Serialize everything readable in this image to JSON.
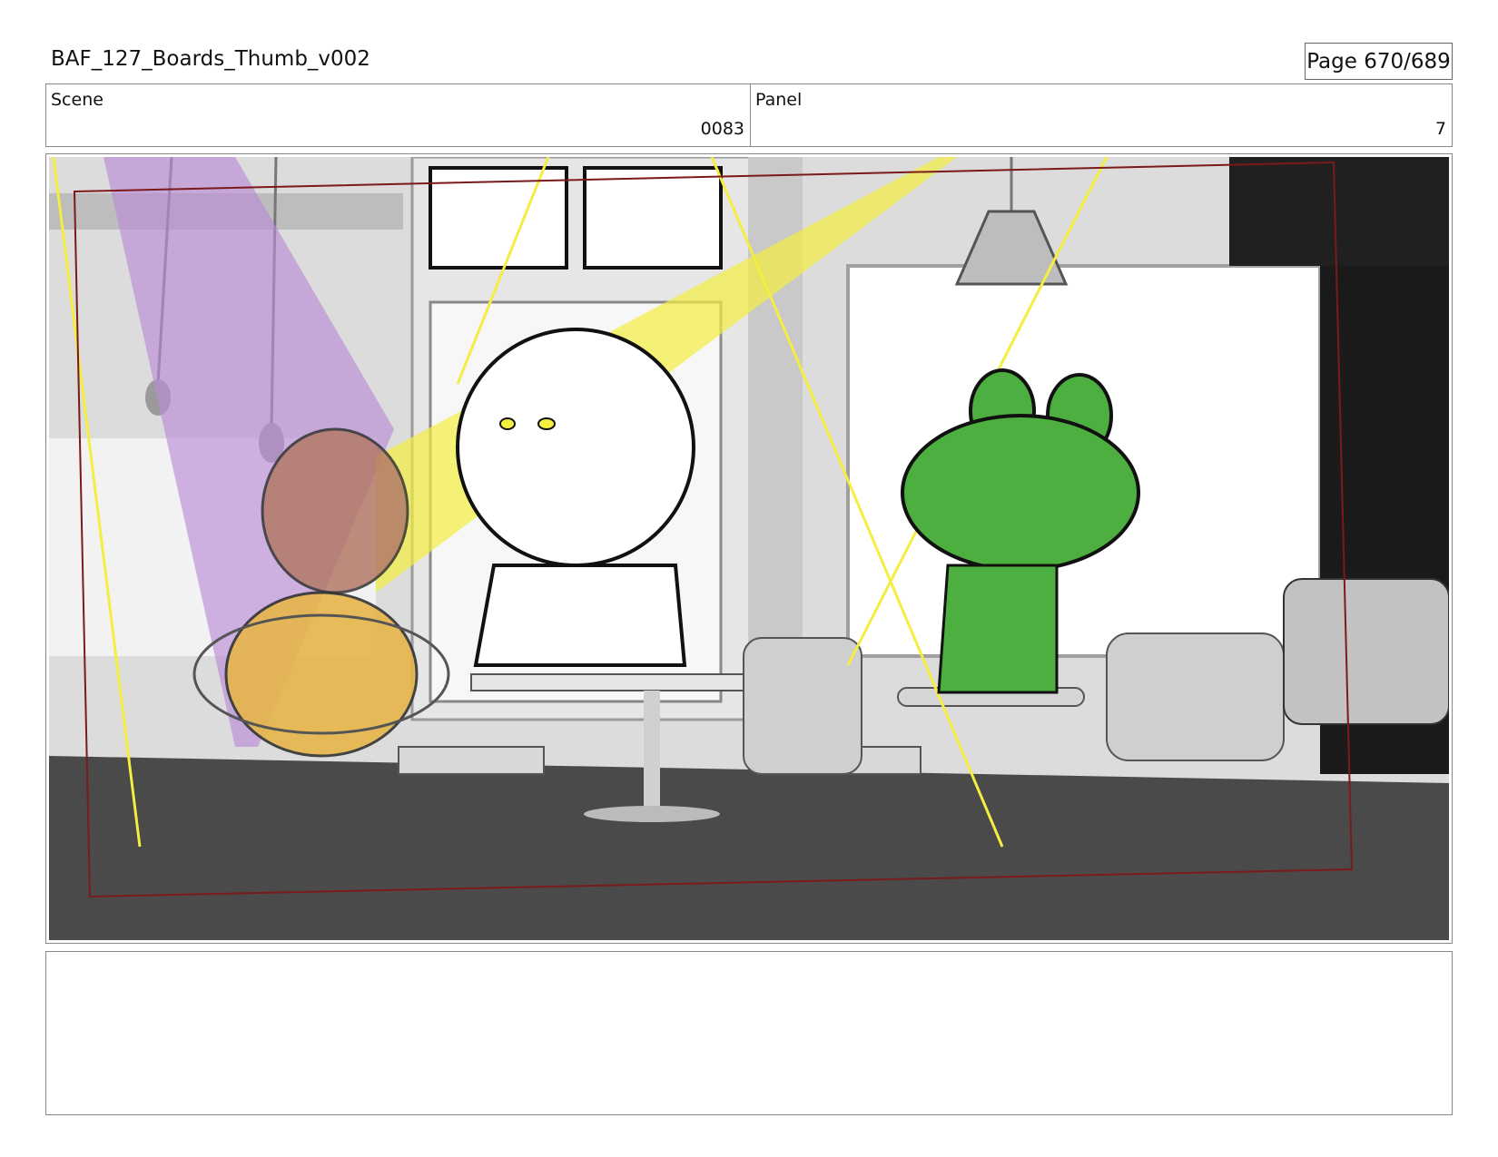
{
  "header": {
    "document_title": "BAF_127_Boards_Thumb_v002",
    "page_label": "Page 670/689"
  },
  "scene": {
    "label": "Scene",
    "value": "0083"
  },
  "panel": {
    "label": "Panel",
    "value": "7"
  },
  "notes": {
    "text": ""
  },
  "colors": {
    "frame_guide": "#7a1a1a",
    "purple_light": "#b98ad6",
    "yellow_light": "#f4ee40",
    "brown_character": "#b37a68",
    "orange_character": "#e6b64a",
    "green_character": "#4caf3f",
    "floor": "#4a4a4a"
  }
}
